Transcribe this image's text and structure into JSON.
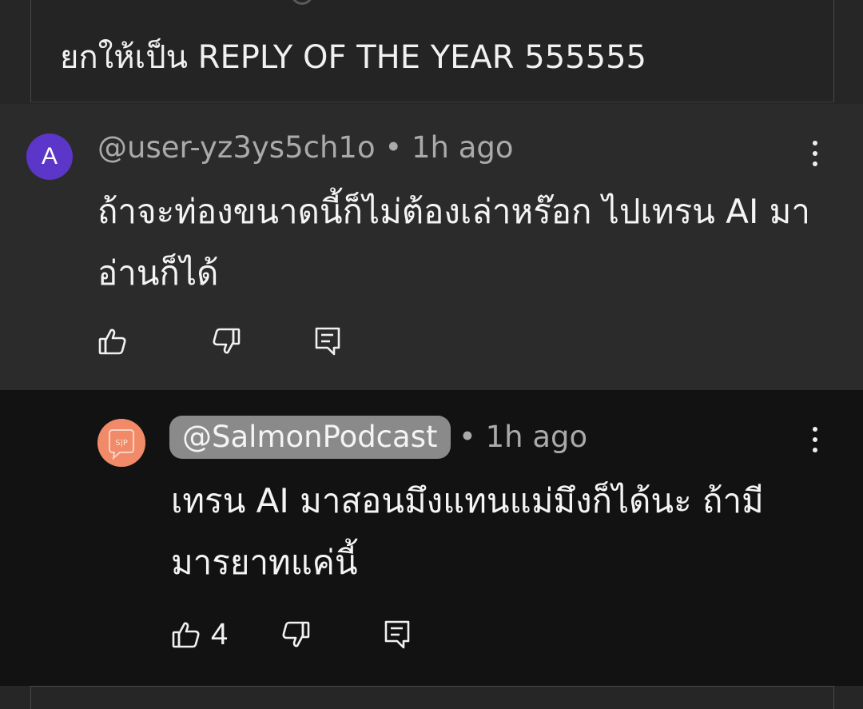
{
  "quoted_comment": {
    "text": "ยกให้เป็น REPLY OF THE YEAR 555555"
  },
  "comment": {
    "avatar_letter": "A",
    "author": "@user-yz3ys5ch1o",
    "separator": "•",
    "time": "1h ago",
    "body": "ถ้าจะท่องขนาดนี้ก็ไม่ต้องเล่าหร๊อก ไปเทรน AI มาอ่านก็ได้",
    "colors": {
      "avatar_bg": "#5c35c9"
    },
    "actions": [
      "like-icon",
      "dislike-icon",
      "reply-icon"
    ]
  },
  "reply": {
    "author": "@SalmonPodcast",
    "separator": "•",
    "time": "1h ago",
    "body": "เทรน AI มาสอนมึงแทนแม่มึงก็ได้นะ ถ้ามีมารยาทแค่นี้",
    "like_count": "4",
    "colors": {
      "avatar_bg": "#f08a68",
      "pill_bg": "#8a8a8a"
    },
    "actions": [
      "like-icon",
      "dislike-icon",
      "reply-icon"
    ]
  }
}
